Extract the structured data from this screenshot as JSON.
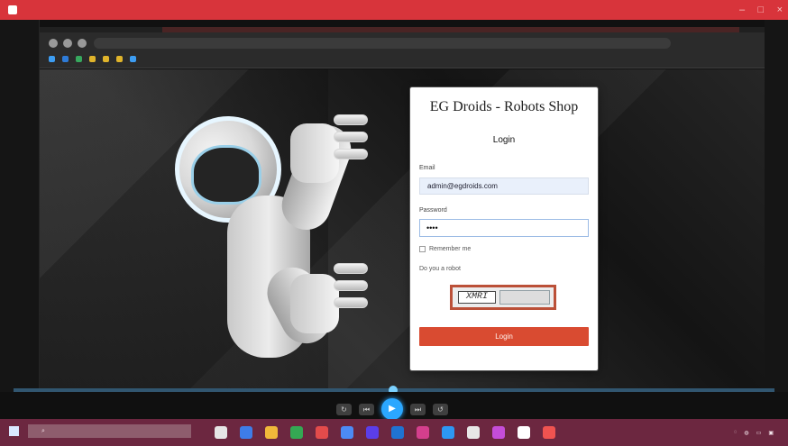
{
  "login_card": {
    "shop_title": "EG Droids - Robots Shop",
    "login_title": "Login",
    "email_label": "Email",
    "email_value": "admin@egdroids.com",
    "password_label": "Password",
    "password_value": "••••",
    "remember_label": "Remember me",
    "code_label": "Do you a robot",
    "captcha_text": "XMRI",
    "login_button": "Login"
  },
  "colors": {
    "titlebar": "#d8343b",
    "taskbar": "#6c2740",
    "login_button": "#d94b31",
    "accent": "#2ba7ff"
  },
  "icons": [
    "app-icon",
    "window-controls",
    "back-icon",
    "forward-icon",
    "refresh-icon",
    "robot-image",
    "play-icon",
    "start-icon",
    "search-icon"
  ]
}
